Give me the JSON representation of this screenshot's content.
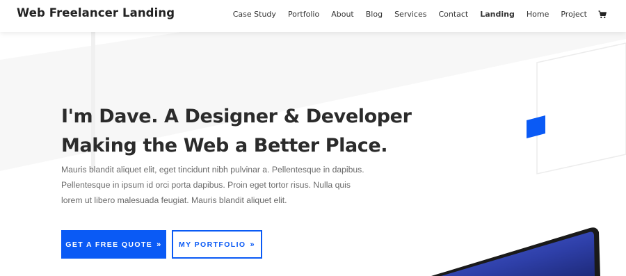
{
  "header": {
    "site_title": "Web Freelancer Landing",
    "nav": [
      {
        "label": "Case Study",
        "active": false
      },
      {
        "label": "Portfolio",
        "active": false
      },
      {
        "label": "About",
        "active": false
      },
      {
        "label": "Blog",
        "active": false
      },
      {
        "label": "Services",
        "active": false
      },
      {
        "label": "Contact",
        "active": false
      },
      {
        "label": "Landing",
        "active": true
      },
      {
        "label": "Home",
        "active": false
      },
      {
        "label": "Project",
        "active": false
      }
    ],
    "cart_icon": "shopping-cart-icon"
  },
  "hero": {
    "headline_line1": "I'm Dave. A Designer & Developer",
    "headline_line2": "Making the Web a Better Place.",
    "body": "Mauris blandit aliquet elit, eget tincidunt nibh pulvinar a. Pellentesque in dapibus. Pellentesque in ipsum id orci porta dapibus. Proin eget tortor risus. Nulla quis lorem ut libero malesuada feugiat. Mauris blandit aliquet elit.",
    "primary_button": "GET A FREE QUOTE",
    "secondary_button": "MY PORTFOLIO",
    "button_icon": "double-chevron-right-icon"
  },
  "colors": {
    "accent": "#0a5af5",
    "headline": "#2b2b2b",
    "body_text": "#6a6a6a",
    "background": "#ffffff"
  }
}
